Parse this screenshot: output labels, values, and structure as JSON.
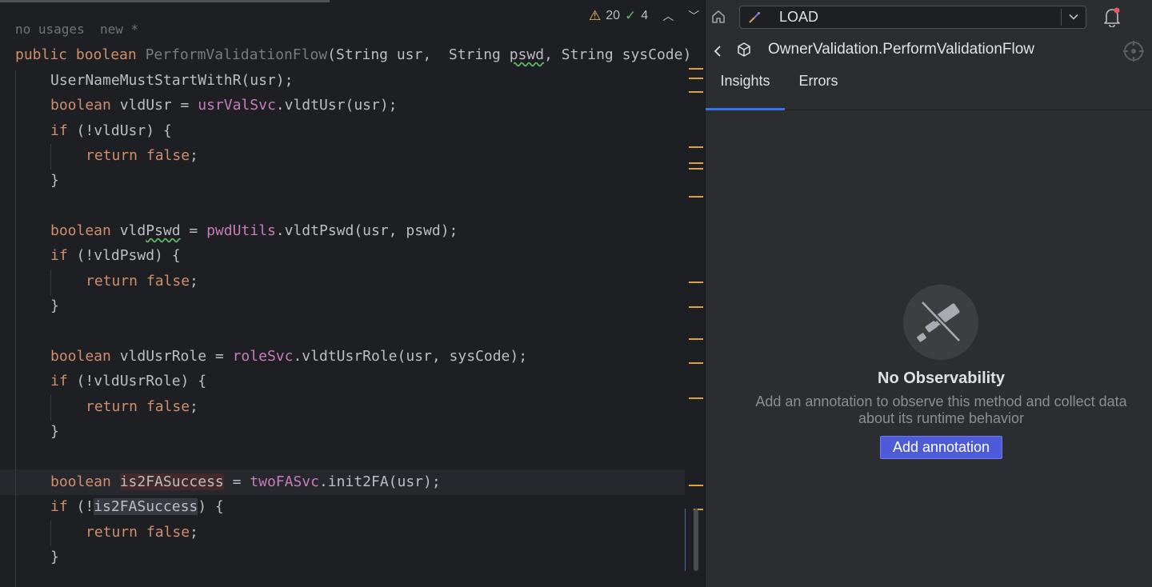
{
  "editor": {
    "hint_usages": "no usages",
    "hint_new": "new *",
    "toolbar": {
      "warnings_count": "20",
      "checks_count": "4",
      "warning_icon": "warning-triangle-icon",
      "check_icon": "double-check-icon"
    },
    "lines": [
      {
        "indent": 0,
        "parts": [
          {
            "t": "public boolean ",
            "c": "kw"
          },
          {
            "t": "PerformValidationFlow",
            "c": "fn-dim"
          },
          {
            "t": "(String usr,  String "
          },
          {
            "t": "pswd",
            "c": "wavy"
          },
          {
            "t": ", String sysCode)"
          }
        ]
      },
      {
        "indent": 1,
        "parts": [
          {
            "t": "UserNameMustStartWithR(usr);"
          }
        ]
      },
      {
        "indent": 1,
        "parts": [
          {
            "t": "boolean ",
            "c": "kw"
          },
          {
            "t": "vldUsr = "
          },
          {
            "t": "usrValSvc",
            "c": "fld"
          },
          {
            "t": ".vldtUsr(usr);"
          }
        ]
      },
      {
        "indent": 1,
        "parts": [
          {
            "t": "if ",
            "c": "kw"
          },
          {
            "t": "(!vldUsr) {"
          }
        ]
      },
      {
        "indent": 2,
        "parts": [
          {
            "t": "return false",
            "c": "kw"
          },
          {
            "t": ";"
          }
        ]
      },
      {
        "indent": 1,
        "parts": [
          {
            "t": "}"
          }
        ]
      },
      {
        "indent": 0,
        "parts": []
      },
      {
        "indent": 1,
        "parts": [
          {
            "t": "boolean ",
            "c": "kw"
          },
          {
            "t": "vld"
          },
          {
            "t": "Pswd",
            "c": "wavy"
          },
          {
            "t": " = "
          },
          {
            "t": "pwdUtils",
            "c": "fld"
          },
          {
            "t": ".vldtPswd(usr, pswd);"
          }
        ]
      },
      {
        "indent": 1,
        "parts": [
          {
            "t": "if ",
            "c": "kw"
          },
          {
            "t": "(!vldPswd) {"
          }
        ]
      },
      {
        "indent": 2,
        "parts": [
          {
            "t": "return false",
            "c": "kw"
          },
          {
            "t": ";"
          }
        ]
      },
      {
        "indent": 1,
        "parts": [
          {
            "t": "}"
          }
        ]
      },
      {
        "indent": 0,
        "parts": []
      },
      {
        "indent": 1,
        "parts": [
          {
            "t": "boolean ",
            "c": "kw"
          },
          {
            "t": "vldUsrRole = "
          },
          {
            "t": "roleSvc",
            "c": "fld"
          },
          {
            "t": ".vldtUsrRole(usr, sysCode);"
          }
        ]
      },
      {
        "indent": 1,
        "parts": [
          {
            "t": "if ",
            "c": "kw"
          },
          {
            "t": "(!vldUsrRole) {"
          }
        ]
      },
      {
        "indent": 2,
        "parts": [
          {
            "t": "return false",
            "c": "kw"
          },
          {
            "t": ";"
          }
        ]
      },
      {
        "indent": 1,
        "parts": [
          {
            "t": "}"
          }
        ]
      },
      {
        "indent": 0,
        "parts": []
      },
      {
        "indent": 1,
        "parts": [
          {
            "t": "boolean ",
            "c": "kw"
          },
          {
            "t": "is2FASuccess",
            "c": "hl-word"
          },
          {
            "t": " = "
          },
          {
            "t": "twoFASvc",
            "c": "fld"
          },
          {
            "t": ".init2FA(usr);"
          }
        ]
      },
      {
        "indent": 1,
        "parts": [
          {
            "t": "if ",
            "c": "kw"
          },
          {
            "t": "(!"
          },
          {
            "t": "is2FASuccess",
            "c": "hl-read"
          },
          {
            "t": ") {"
          }
        ]
      },
      {
        "indent": 2,
        "parts": [
          {
            "t": "return false",
            "c": "kw"
          },
          {
            "t": ";"
          }
        ]
      },
      {
        "indent": 1,
        "parts": [
          {
            "t": "}"
          }
        ]
      }
    ]
  },
  "panel": {
    "environment": "LOAD",
    "method_title": "OwnerValidation.PerformValidationFlow",
    "tabs": [
      {
        "label": "Insights",
        "active": true
      },
      {
        "label": "Errors",
        "active": false
      }
    ],
    "empty_state": {
      "icon": "telescope-off-icon",
      "title": "No Observability",
      "description": "Add an annotation to observe this method and collect data about its runtime behavior",
      "button": "Add annotation"
    },
    "accent_color": "#3574f0",
    "button_color": "#4e5bd9"
  }
}
